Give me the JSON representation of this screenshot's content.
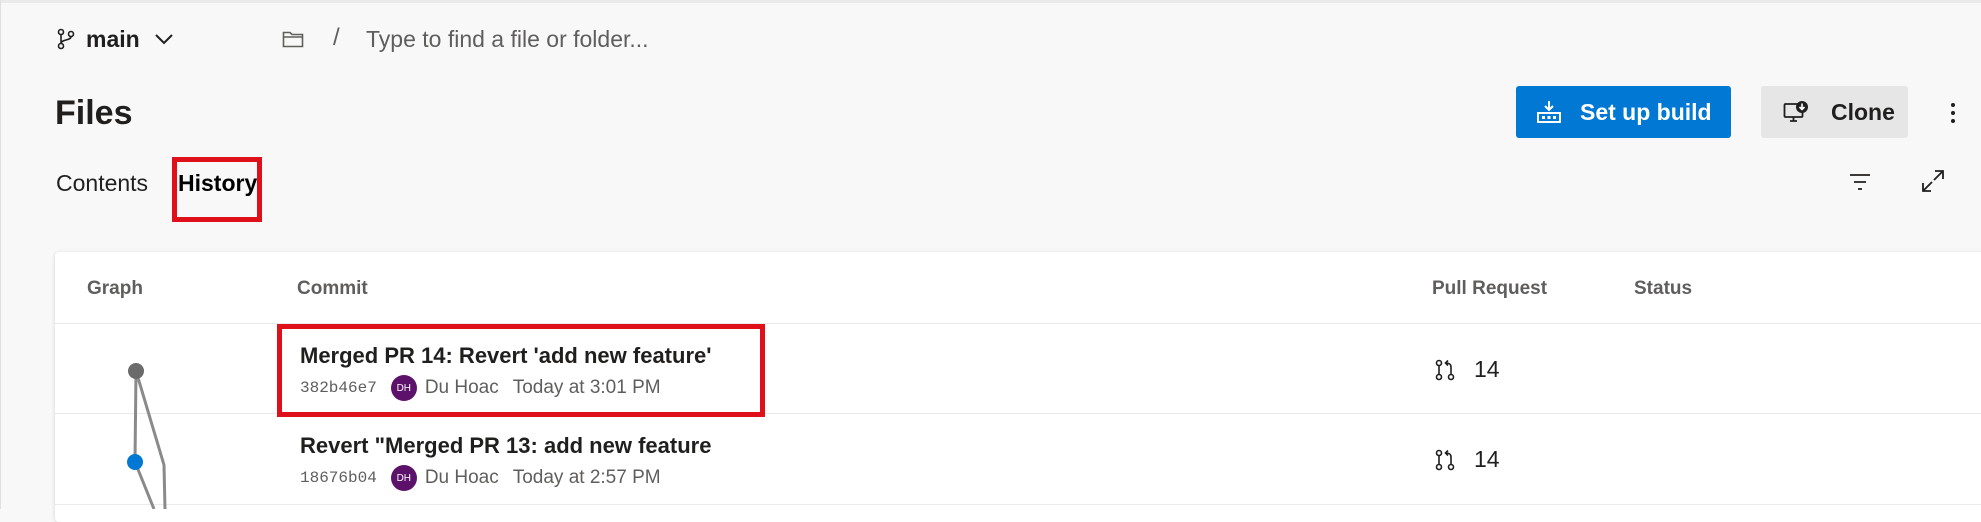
{
  "branch": {
    "name": "main",
    "icon": "git-branch-icon"
  },
  "path": {
    "separator": "/",
    "placeholder": "Type to find a file or folder..."
  },
  "page": {
    "title": "Files"
  },
  "actions": {
    "setup_build": "Set up build",
    "clone": "Clone"
  },
  "tabs": {
    "contents": "Contents",
    "history": "History",
    "selected": "History"
  },
  "table": {
    "headers": {
      "graph": "Graph",
      "commit": "Commit",
      "pull_request": "Pull Request",
      "status": "Status"
    },
    "rows": [
      {
        "title": "Merged PR 14: Revert 'add new feature'",
        "hash": "382b46e7",
        "avatar": "DH",
        "author": "Du Hoac",
        "time": "Today at 3:01 PM",
        "pr": "14"
      },
      {
        "title": "Revert \"Merged PR 13: add new feature",
        "hash": "18676b04",
        "avatar": "DH",
        "author": "Du Hoac",
        "time": "Today at 2:57 PM",
        "pr": "14"
      }
    ]
  },
  "colors": {
    "accent": "#0078d4",
    "highlight": "#e0101a",
    "avatar": "#5c126b",
    "graph_node_gray": "#6b6b6b",
    "graph_node_blue": "#0078d4"
  }
}
